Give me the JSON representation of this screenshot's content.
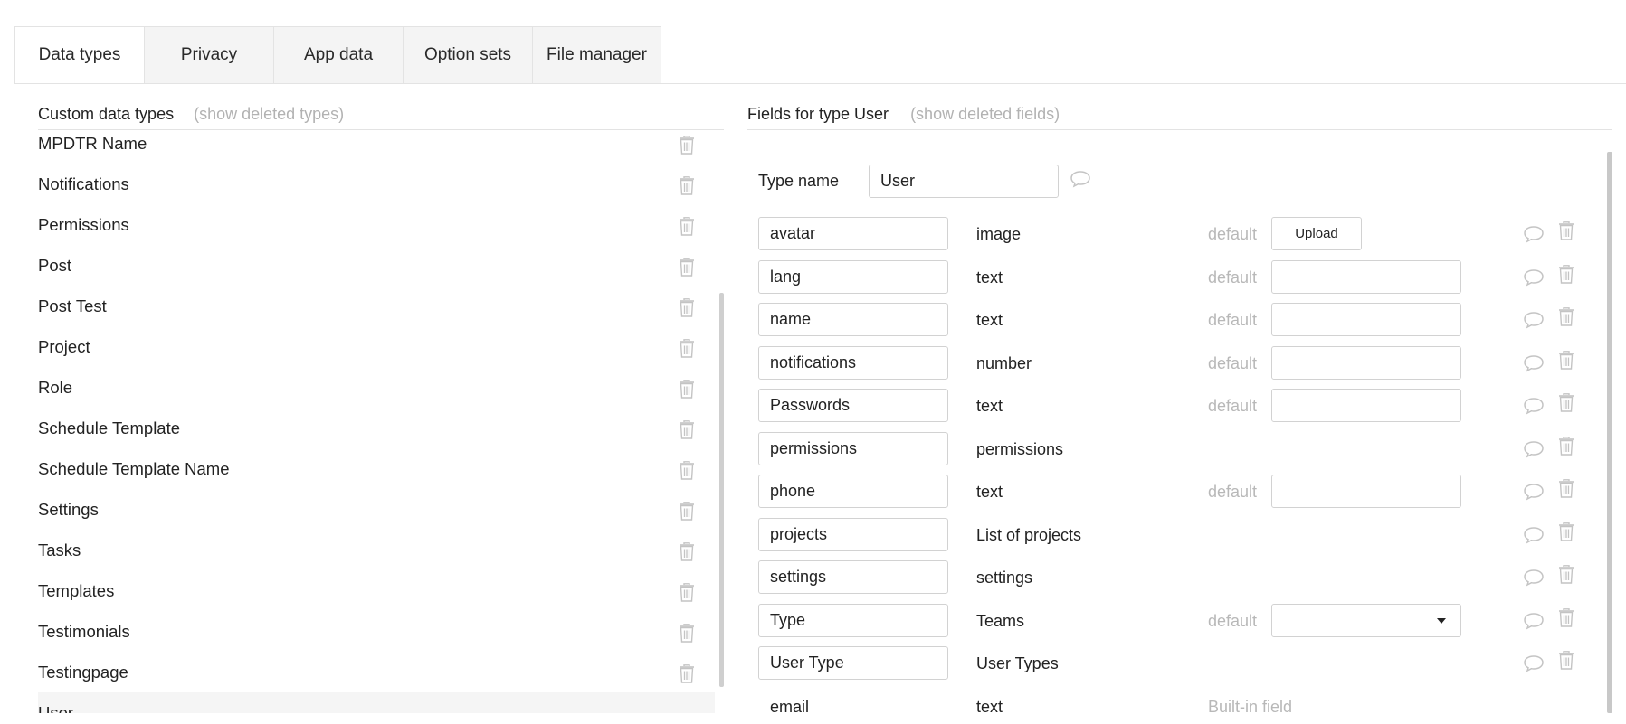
{
  "tabs": [
    {
      "label": "Data types",
      "active": true
    },
    {
      "label": "Privacy",
      "active": false
    },
    {
      "label": "App data",
      "active": false
    },
    {
      "label": "Option sets",
      "active": false
    },
    {
      "label": "File manager",
      "active": false
    }
  ],
  "left_panel": {
    "title": "Custom data types",
    "show_deleted": "(show deleted types)",
    "items": [
      {
        "label": "MPDTR Name"
      },
      {
        "label": "Notifications"
      },
      {
        "label": "Permissions"
      },
      {
        "label": "Post"
      },
      {
        "label": "Post Test"
      },
      {
        "label": "Project"
      },
      {
        "label": "Role"
      },
      {
        "label": "Schedule Template"
      },
      {
        "label": "Schedule Template Name"
      },
      {
        "label": "Settings"
      },
      {
        "label": "Tasks"
      },
      {
        "label": "Templates"
      },
      {
        "label": "Testimonials"
      },
      {
        "label": "Testingpage"
      },
      {
        "label": "User"
      }
    ]
  },
  "right_panel": {
    "title": "Fields for type User",
    "show_deleted": "(show deleted fields)",
    "type_name_label": "Type name",
    "type_name_value": "User",
    "default_label": "default",
    "upload_label": "Upload",
    "builtin_label": "Built-in field",
    "fields": [
      {
        "name": "avatar",
        "type": "image"
      },
      {
        "name": "lang",
        "type": "text"
      },
      {
        "name": "name",
        "type": "text"
      },
      {
        "name": "notifications",
        "type": "number"
      },
      {
        "name": "Passwords",
        "type": "text"
      },
      {
        "name": "permissions",
        "type": "permissions"
      },
      {
        "name": "phone",
        "type": "text"
      },
      {
        "name": "projects",
        "type": "List of projects"
      },
      {
        "name": "settings",
        "type": "settings"
      },
      {
        "name": "Type",
        "type": "Teams"
      },
      {
        "name": "User Type",
        "type": "User Types"
      },
      {
        "name": "email",
        "type": "text"
      }
    ]
  },
  "colors": {
    "muted_text": "#b2b2b2",
    "icon_gray": "#c4c4c4",
    "border": "#d2d2d2",
    "tab_inactive_bg": "#f4f4f4"
  }
}
